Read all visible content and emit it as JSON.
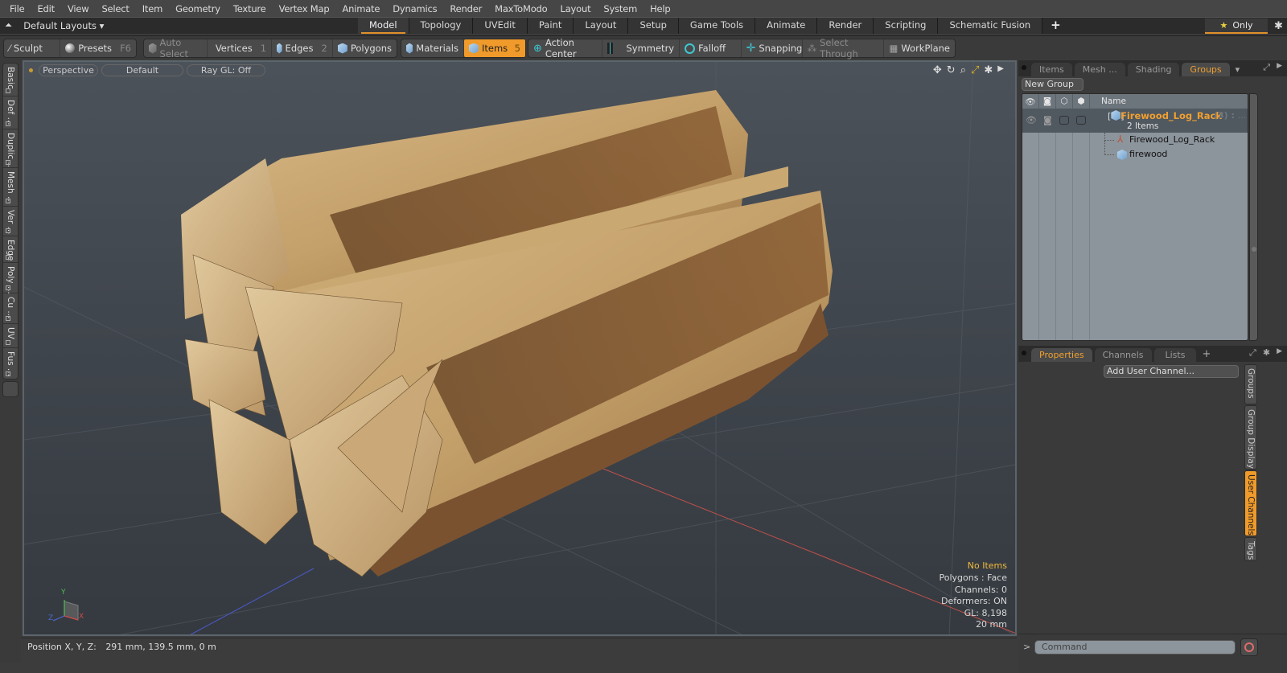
{
  "menu": [
    "File",
    "Edit",
    "View",
    "Select",
    "Item",
    "Geometry",
    "Texture",
    "Vertex Map",
    "Animate",
    "Dynamics",
    "Render",
    "MaxToModo",
    "Layout",
    "System",
    "Help"
  ],
  "layout_bar": {
    "layouts_label": "Default Layouts",
    "tabs": [
      "Model",
      "Topology",
      "UVEdit",
      "Paint",
      "Layout",
      "Setup",
      "Game Tools",
      "Animate",
      "Render",
      "Scripting",
      "Schematic Fusion"
    ],
    "active_tab": "Model",
    "add_tab": "+",
    "only_label": "Only"
  },
  "toolbar": {
    "sculpt": "Sculpt",
    "presets": "Presets",
    "presets_key": "F6",
    "auto_select": "Auto Select",
    "vertices": "Vertices",
    "vertices_key": "1",
    "edges": "Edges",
    "edges_key": "2",
    "polygons": "Polygons",
    "materials": "Materials",
    "items": "Items",
    "items_key": "5",
    "action_center": "Action Center",
    "symmetry": "Symmetry",
    "falloff": "Falloff",
    "snapping": "Snapping",
    "select_through": "Select Through",
    "workplane": "WorkPlane"
  },
  "left_tabs": [
    "Basic",
    "Def ...",
    "Duplic...",
    "Mesh ...",
    "Ver ...",
    "Edge",
    "Poly ...",
    "Cu ...",
    "UV",
    "Fus ..."
  ],
  "viewport": {
    "view": "Perspective",
    "shading": "Default",
    "raygl": "Ray GL: Off",
    "hud": {
      "selection": "No Items",
      "polygons": "Polygons : Face",
      "channels": "Channels: 0",
      "deformers": "Deformers: ON",
      "gl": "GL: 8,198",
      "scale": "20 mm"
    },
    "axes": {
      "x": "X",
      "y": "Y",
      "z": "Z"
    }
  },
  "status": {
    "position_label": "Position X, Y, Z:",
    "position_value": "291 mm, 139.5 mm, 0 m"
  },
  "groups_panel": {
    "tabs": [
      "Items",
      "Mesh ...",
      "Shading",
      "Groups"
    ],
    "active_tab": "Groups",
    "new_group": "New Group",
    "name_header": "Name",
    "group": {
      "name": "Firewood_Log_Rack",
      "count": "(3) :",
      "more": "...",
      "items_label": "2 Items"
    },
    "children": [
      {
        "name": "Firewood_Log_Rack",
        "icon": "locator-icon"
      },
      {
        "name": "firewood",
        "icon": "mesh-icon"
      }
    ]
  },
  "properties_panel": {
    "tabs": [
      "Properties",
      "Channels",
      "Lists"
    ],
    "active_tab": "Properties",
    "add_tab": "+",
    "add_user_channel": "Add User Channel...",
    "side_tabs": [
      "Groups",
      "Group Display",
      "User Channels",
      "Tags"
    ],
    "active_side_tab": "User Channels"
  },
  "command": {
    "prompt": ">",
    "placeholder": "Command"
  }
}
